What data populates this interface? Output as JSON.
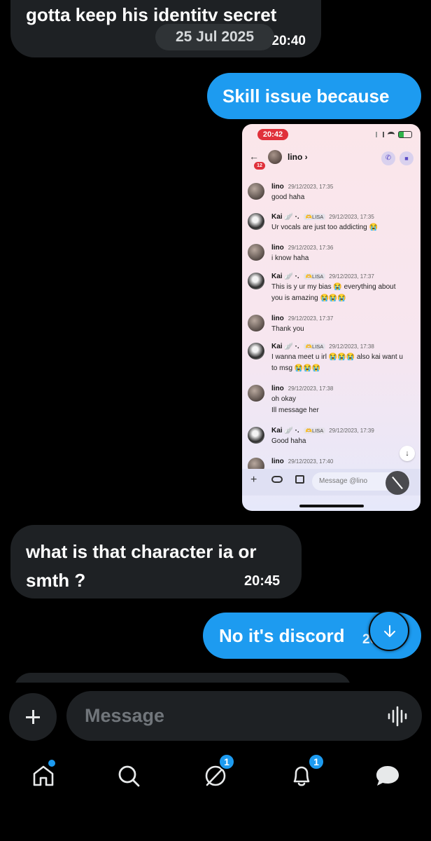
{
  "messages": [
    {
      "side": "in",
      "text": "gotta keep his identitv secret",
      "time": "20:40"
    },
    {
      "side": "out",
      "text": "Skill issue because"
    },
    {
      "side": "in",
      "text": "what is that character ia or smth ?",
      "time": "20:45"
    },
    {
      "side": "out",
      "text": "No it's discord",
      "time": "20:45"
    }
  ],
  "date_divider": "25 Jul 2025",
  "attached_screenshot": {
    "status_time": "20:42",
    "back_badge": "12",
    "contact_name": "lino",
    "contact_chevron": "›",
    "messages": [
      {
        "author": "lino",
        "tag": "",
        "timestamp": "29/12/2023, 17:35",
        "lines": [
          "good haha"
        ]
      },
      {
        "author": "Kai 🪽 ·.",
        "tag": "🫶LISA",
        "timestamp": "29/12/2023, 17:35",
        "lines": [
          "Ur vocals are just too addicting 😭"
        ]
      },
      {
        "author": "lino",
        "tag": "",
        "timestamp": "29/12/2023, 17:36",
        "lines": [
          "i know haha"
        ]
      },
      {
        "author": "Kai 🪽 ·.",
        "tag": "🫶LISA",
        "timestamp": "29/12/2023, 17:37",
        "lines": [
          "This is y ur my bias 😭 everything about",
          "you is amazing 😭😭😭"
        ]
      },
      {
        "author": "lino",
        "tag": "",
        "timestamp": "29/12/2023, 17:37",
        "lines": [
          "Thank you"
        ]
      },
      {
        "author": "Kai 🪽 ·.",
        "tag": "🫶LISA",
        "timestamp": "29/12/2023, 17:38",
        "lines": [
          "I wanna meet u irl 😭😭😭 also kai want u",
          "to msg 😭😭😭"
        ]
      },
      {
        "author": "lino",
        "tag": "",
        "timestamp": "29/12/2023, 17:38",
        "lines": [
          "oh okay",
          "Ill message her"
        ]
      },
      {
        "author": "Kai 🪽 ·.",
        "tag": "🫶LISA",
        "timestamp": "29/12/2023, 17:39",
        "lines": [
          "Good haha"
        ]
      },
      {
        "author": "lino",
        "tag": "",
        "timestamp": "29/12/2023, 17:40",
        "lines": []
      }
    ],
    "composer_placeholder": "Message @lino"
  },
  "composer": {
    "placeholder": "Message"
  },
  "tabs": [
    {
      "name": "home",
      "icon": "home-icon",
      "dot": true
    },
    {
      "name": "search",
      "icon": "search-icon"
    },
    {
      "name": "spaces",
      "icon": "spaces-icon",
      "badge": "1"
    },
    {
      "name": "notifications",
      "icon": "bell-icon",
      "badge": "1"
    },
    {
      "name": "messages",
      "icon": "messages-icon"
    }
  ],
  "colors": {
    "accent": "#1d9bf0",
    "bubble_in": "#1e2124",
    "background": "#000000"
  }
}
